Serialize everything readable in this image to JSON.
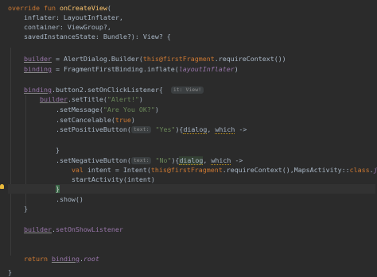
{
  "code": {
    "l1": {
      "kw": "override fun",
      "fn": "onCreateView",
      "rest": "("
    },
    "l2": {
      "text": "    inflater: LayoutInflater,"
    },
    "l3": {
      "text": "    container: ViewGroup?,"
    },
    "l4": {
      "text": "    savedInstanceState: Bundle?): View? {"
    },
    "l6": {
      "var": "builder",
      "a": " = AlertDialog.Builder(",
      "kw": "this",
      "lbl": "@firstFragment",
      "b": ".requireContext())"
    },
    "l7": {
      "var": "binding",
      "a": " = FragmentFirstBinding.inflate(",
      "param": "layoutInflater",
      "b": ")"
    },
    "l9": {
      "var": "binding",
      "a": ".button2.setOnClickListener{",
      "hint": "it: View!"
    },
    "l10": {
      "var": "builder",
      "a": ".setTitle(",
      "str": "\"Alert!\"",
      "b": ")"
    },
    "l11": {
      "a": ".setMessage(",
      "str": "\"Are You OK?\"",
      "b": ")"
    },
    "l12": {
      "a": ".setCancelable(",
      "kw": "true",
      "b": ")"
    },
    "l13": {
      "a": ".setPositiveButton(",
      "hint": "text:",
      "str": "\"Yes\"",
      "b": "){",
      "p1": "dialog",
      "c": ", ",
      "p2": "which",
      "d": " ->"
    },
    "l15": {
      "text": "}"
    },
    "l16": {
      "a": ".setNegativeButton(",
      "hint": "text:",
      "str": "\"No\"",
      "b": "){",
      "p1": "dialog",
      "c": ", ",
      "p2": "which",
      "d": " ->"
    },
    "l17": {
      "kw": "val",
      "a": " intent = Intent(",
      "kw2": "this",
      "lbl": "@firstFragment",
      "b": ".requireContext(),MapsActivity::",
      "kw3": "class",
      "c": ".",
      "prop": "java",
      "d": ")"
    },
    "l18": {
      "text": "startActivity(intent)"
    },
    "l19": {
      "text": "}"
    },
    "l20": {
      "text": ".show()"
    },
    "l21": {
      "text": "}"
    },
    "l23": {
      "var": "builder",
      "a": ".",
      "prop": "setOnShowListener"
    },
    "l26": {
      "kw": "return",
      "var": "binding",
      "a": ".",
      "prop": "root"
    },
    "l27": {
      "text": "}"
    }
  },
  "colors": {
    "background": "#2b2b2b",
    "keyword": "#cc7832",
    "function": "#ffc66d",
    "string": "#6a8759",
    "property": "#9876aa",
    "default": "#a9b7c6"
  }
}
